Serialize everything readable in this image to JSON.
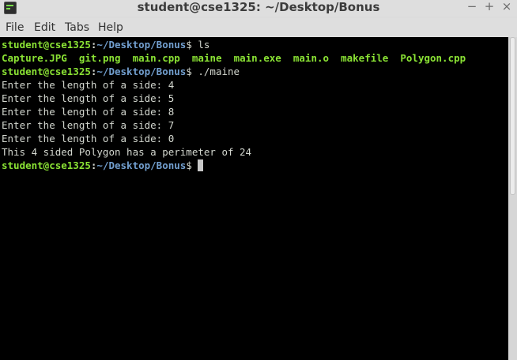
{
  "window": {
    "title": "student@cse1325: ~/Desktop/Bonus",
    "minimize": "−",
    "maximize": "+",
    "close": "×"
  },
  "menu": [
    "File",
    "Edit",
    "Tabs",
    "Help"
  ],
  "prompt": {
    "user": "student@cse1325",
    "colon": ":",
    "path": "~/Desktop/Bonus",
    "symbol": "$"
  },
  "terminal": {
    "cmd1": " ls",
    "ls_files": [
      "Capture.JPG",
      "git.png",
      "main.cpp",
      "maine",
      "main.exe",
      "main.o",
      "makefile",
      "Polygon.cpp"
    ],
    "cmd2": " ./maine",
    "output": [
      "Enter the length of a side: 4",
      "Enter the length of a side: 5",
      "Enter the length of a side: 8",
      "Enter the length of a side: 7",
      "Enter the length of a side: 0",
      "This 4 sided Polygon has a perimeter of 24"
    ],
    "cmd3": " "
  },
  "colors": {
    "user": "#8ae234",
    "path": "#729fcf",
    "text": "#d3d7cf",
    "background": "#000000"
  }
}
